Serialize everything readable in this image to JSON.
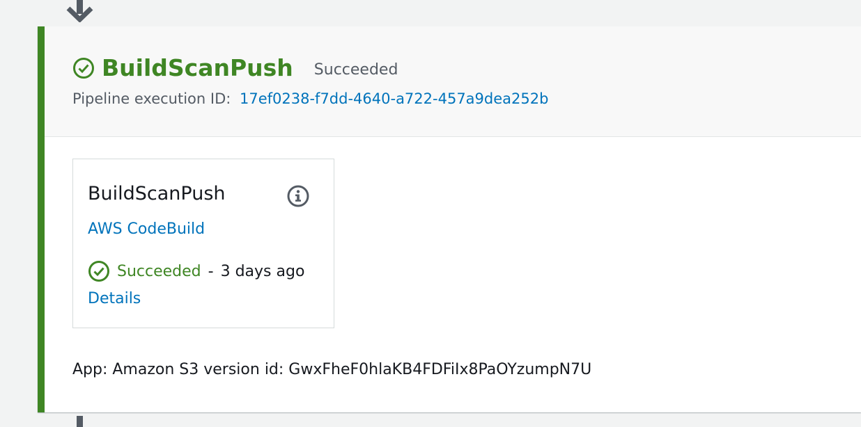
{
  "stage": {
    "name": "BuildScanPush",
    "status": "Succeeded",
    "execution_label": "Pipeline execution ID:",
    "execution_id": "17ef0238-f7dd-4640-a722-457a9dea252b"
  },
  "action": {
    "name": "BuildScanPush",
    "provider": "AWS CodeBuild",
    "status": "Succeeded",
    "separator": "-",
    "time": "3 days ago",
    "details_label": "Details"
  },
  "footer": {
    "text": "App: Amazon S3 version id: GwxFheF0hlaKB4FDFiIx8PaOYzumpN7U"
  },
  "icons": {
    "stage_status": "check-circle-icon",
    "action_status": "check-circle-icon",
    "info": "info-circle-icon",
    "connector": "arrow-down-icon"
  },
  "colors": {
    "success": "#3f8624",
    "link": "#0073bb",
    "text": "#16191f",
    "muted": "#545b64"
  }
}
